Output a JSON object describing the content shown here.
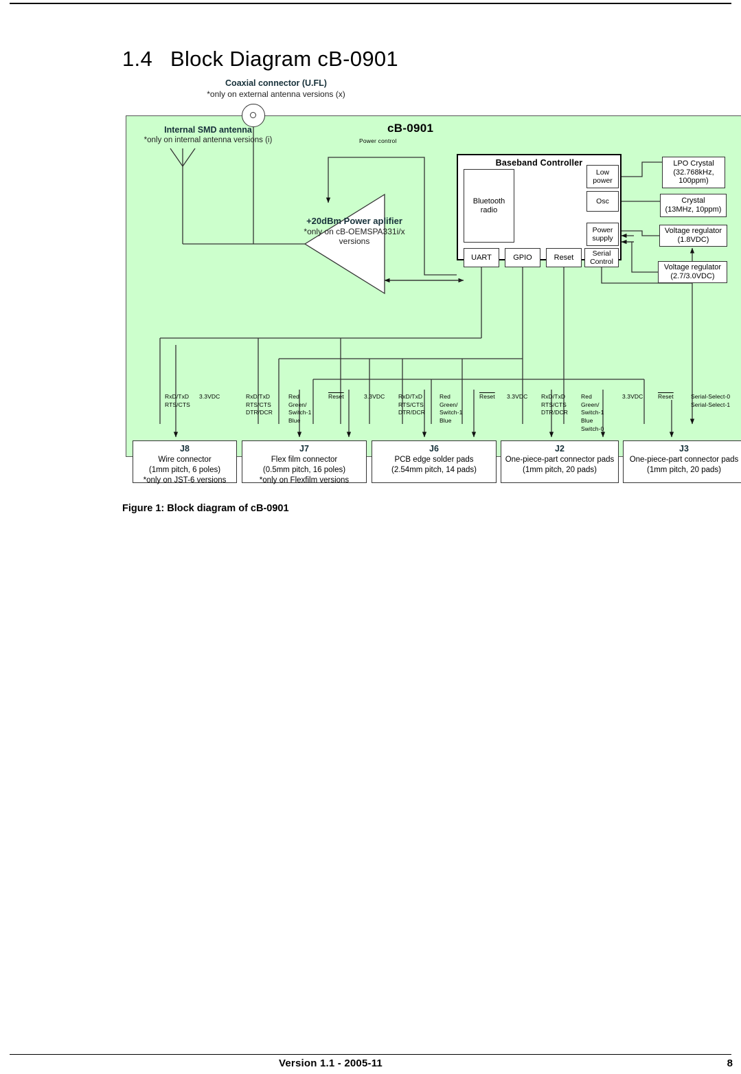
{
  "page": {
    "section_number": "1.4",
    "section_title": "Block Diagram cB-0901",
    "figure_caption": "Figure 1:  Block diagram of cB-0901",
    "footer_version": "Version 1.1 - 2005-11",
    "footer_page": "8",
    "accent_color": "#17313a",
    "canvas_color": "#ccffcc"
  },
  "diagram": {
    "title": "cB-0901",
    "coax": {
      "title": "Coaxial connector (U.FL)",
      "note": "*only on external antenna versions (x)"
    },
    "antenna": {
      "title": "Internal SMD antenna",
      "note": "*only on internal antenna versions (i)"
    },
    "power_amplifier": {
      "line1": "+20dBm Power aplifier",
      "line2": "*only on cB-OEMSPA331i/x",
      "line3": "versions"
    },
    "power_control_label": "Power control",
    "baseband": {
      "title": "Baseband Controller",
      "bluetooth_radio": "Bluetooth\nradio",
      "low_power": "Low\npower",
      "osc": "Osc",
      "power_supply": "Power\nsupply",
      "uart": "UART",
      "gpio": "GPIO",
      "reset": "Reset",
      "serial_control": "Serial\nControl"
    },
    "peripherals": {
      "lpo_crystal": "LPO Crystal\n(32.768kHz,\n100ppm)",
      "crystal": "Crystal\n(13MHz, 10ppm)",
      "vreg_18": "Voltage regulator\n(1.8VDC)",
      "vreg_27": "Voltage regulator\n(2.7/3.0VDC)"
    },
    "connectors": [
      {
        "id": "J8",
        "line1": "Wire connector",
        "line2": "(1mm pitch, 6 poles)",
        "line3": "*only on JST-6 versions"
      },
      {
        "id": "J7",
        "line1": "Flex film connector",
        "line2": "(0.5mm pitch, 16 poles)",
        "line3": "*only on Flexfilm versions"
      },
      {
        "id": "J6",
        "line1": "PCB edge solder pads",
        "line2": "(2.54mm pitch, 14 pads)",
        "line3": ""
      },
      {
        "id": "J2",
        "line1": "One-piece-part connector pads",
        "line2": "(1mm pitch, 20 pads)",
        "line3": ""
      },
      {
        "id": "J3",
        "line1": "One-piece-part connector pads",
        "line2": "(1mm pitch, 20 pads)",
        "line3": ""
      }
    ],
    "signals": [
      {
        "text": "RxD/TxD\nRTS/CTS"
      },
      {
        "text": "3.3VDC"
      },
      {
        "text": "RxD/TxD\nRTS/CTS\nDTR/DCR"
      },
      {
        "text": "Red\nGreen/\nSwitch-1\nBlue"
      },
      {
        "text": "Reset"
      },
      {
        "text": "3.3VDC"
      },
      {
        "text": "RxD/TxD\nRTS/CTS\nDTR/DCR"
      },
      {
        "text": "Red\nGreen/\nSwitch-1\nBlue"
      },
      {
        "text": "Reset"
      },
      {
        "text": "3.3VDC"
      },
      {
        "text": "RxD/TxD\nRTS/CTS\nDTR/DCR"
      },
      {
        "text": "Red\nGreen/\nSwitch-1\nBlue\nSwitch-0"
      },
      {
        "text": "3.3VDC"
      },
      {
        "text": "Reset"
      },
      {
        "text": "Serial-Select-0\nSerial-Select-1"
      }
    ]
  }
}
